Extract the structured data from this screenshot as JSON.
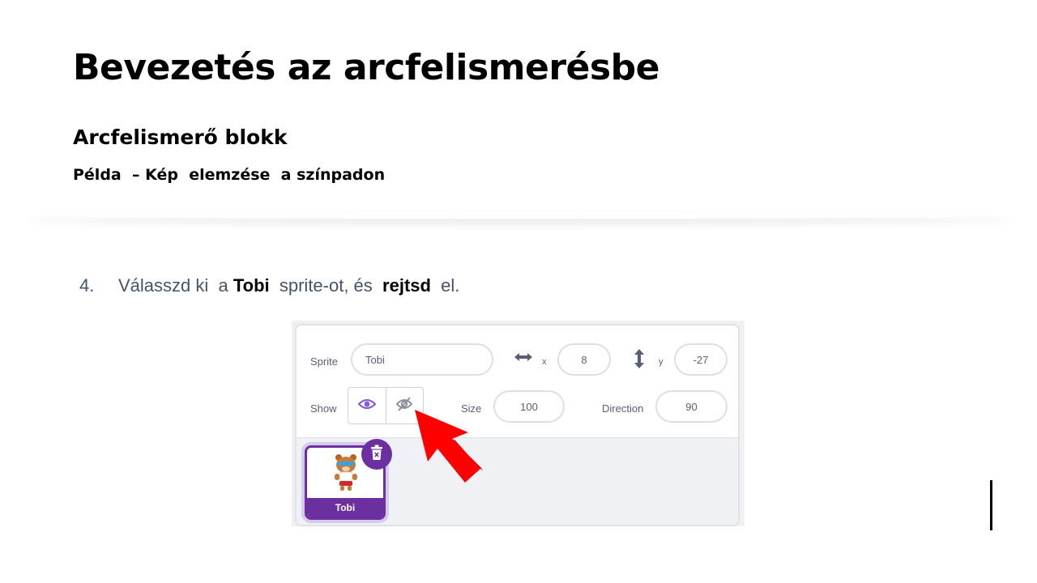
{
  "slide": {
    "title": "Bevezetés az arcfelismerésbe",
    "subtitle": "Arcfelismerő blokk",
    "subsubtitle": "Példa  – Kép  elemzése  a színpadon"
  },
  "step": {
    "number": "4.",
    "text_before": "Válasszd ki  a ",
    "bold_1": "Tobi",
    "text_middle": "  sprite-ot, és  ",
    "bold_2": "rejtsd",
    "text_after": "  el."
  },
  "sprite_panel": {
    "sprite_label": "Sprite",
    "sprite_value": "Tobi",
    "x_label": "x",
    "x_value": "8",
    "y_label": "y",
    "y_value": "-27",
    "show_label": "Show",
    "size_label": "Size",
    "size_value": "100",
    "direction_label": "Direction",
    "direction_value": "90",
    "selected_show_state": "hidden",
    "sprite_tile_name": "Tobi",
    "icons": [
      "x-arrows-icon",
      "y-arrows-icon",
      "eye-icon",
      "eye-slash-icon",
      "trash-icon",
      "red-arrow-pointer"
    ]
  },
  "colors": {
    "accent_purple": "#6b2fa0",
    "step_text": "#44546a",
    "arrow_red": "#ff0000"
  }
}
